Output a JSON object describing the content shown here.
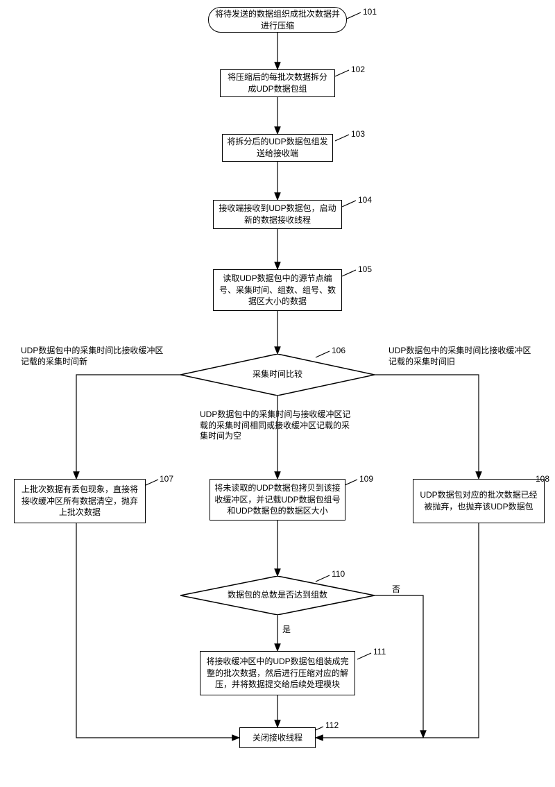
{
  "nodes": {
    "n101": {
      "num": "101",
      "text": "将待发送的数据组织成批次数据并进行压缩"
    },
    "n102": {
      "num": "102",
      "text": "将压缩后的每批次数据拆分成UDP数据包组"
    },
    "n103": {
      "num": "103",
      "text": "将拆分后的UDP数据包组发送给接收端"
    },
    "n104": {
      "num": "104",
      "text": "接收端接收到UDP数据包，启动新的数据接收线程"
    },
    "n105": {
      "num": "105",
      "text": "读取UDP数据包中的源节点编号、采集时间、组数、组号、数据区大小的数据"
    },
    "n106": {
      "num": "106",
      "text": "采集时间比较"
    },
    "n107": {
      "num": "107",
      "text": "上批次数据有丢包现象，直接将接收缓冲区所有数据清空，抛弃上批次数据"
    },
    "n108": {
      "num": "108",
      "text": "UDP数据包对应的批次数据已经被抛弃，也抛弃该UDP数据包"
    },
    "n109": {
      "num": "109",
      "text": "将未读取的UDP数据包拷贝到该接收缓冲区，并记载UDP数据包组号和UDP数据包的数据区大小"
    },
    "n110": {
      "num": "110",
      "text": "数据包的总数是否达到组数"
    },
    "n111": {
      "num": "111",
      "text": "将接收缓冲区中的UDP数据包组装成完整的批次数据，然后进行压缩对应的解压，并将数据提交给后续处理模块"
    },
    "n112": {
      "num": "112",
      "text": "关闭接收线程"
    }
  },
  "labels": {
    "left106": "UDP数据包中的采集时间比接收缓冲区记载的采集时间新",
    "right106": "UDP数据包中的采集时间比接收缓冲区记载的采集时间旧",
    "mid106": "UDP数据包中的采集时间与接收缓冲区记载的采集时间相同或接收缓冲区记载的采集时间为空",
    "yes": "是",
    "no": "否"
  }
}
